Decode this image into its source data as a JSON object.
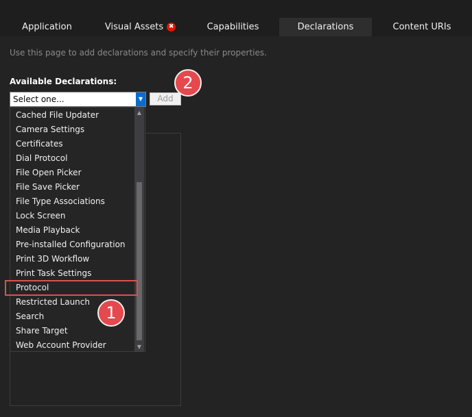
{
  "tabs": [
    {
      "label": "Application"
    },
    {
      "label": "Visual Assets",
      "error_icon": "✖"
    },
    {
      "label": "Capabilities"
    },
    {
      "label": "Declarations",
      "active": true
    },
    {
      "label": "Content URIs"
    }
  ],
  "intro": "Use this page to add declarations and specify their properties.",
  "available_label": "Available Declarations:",
  "select": {
    "value": "Select one..."
  },
  "add_button": "Add",
  "dropdown_items": [
    "Cached File Updater",
    "Camera Settings",
    "Certificates",
    "Dial Protocol",
    "File Open Picker",
    "File Save Picker",
    "File Type Associations",
    "Lock Screen",
    "Media Playback",
    "Pre-installed Configuration",
    "Print 3D Workflow",
    "Print Task Settings",
    "Protocol",
    "Restricted Launch",
    "Search",
    "Share Target",
    "Web Account Provider"
  ],
  "callouts": {
    "one": "1",
    "two": "2"
  },
  "colors": {
    "accent": "#0a6cd0",
    "highlight": "#d9534f",
    "callout": "#e5484d",
    "error": "#e51400"
  }
}
